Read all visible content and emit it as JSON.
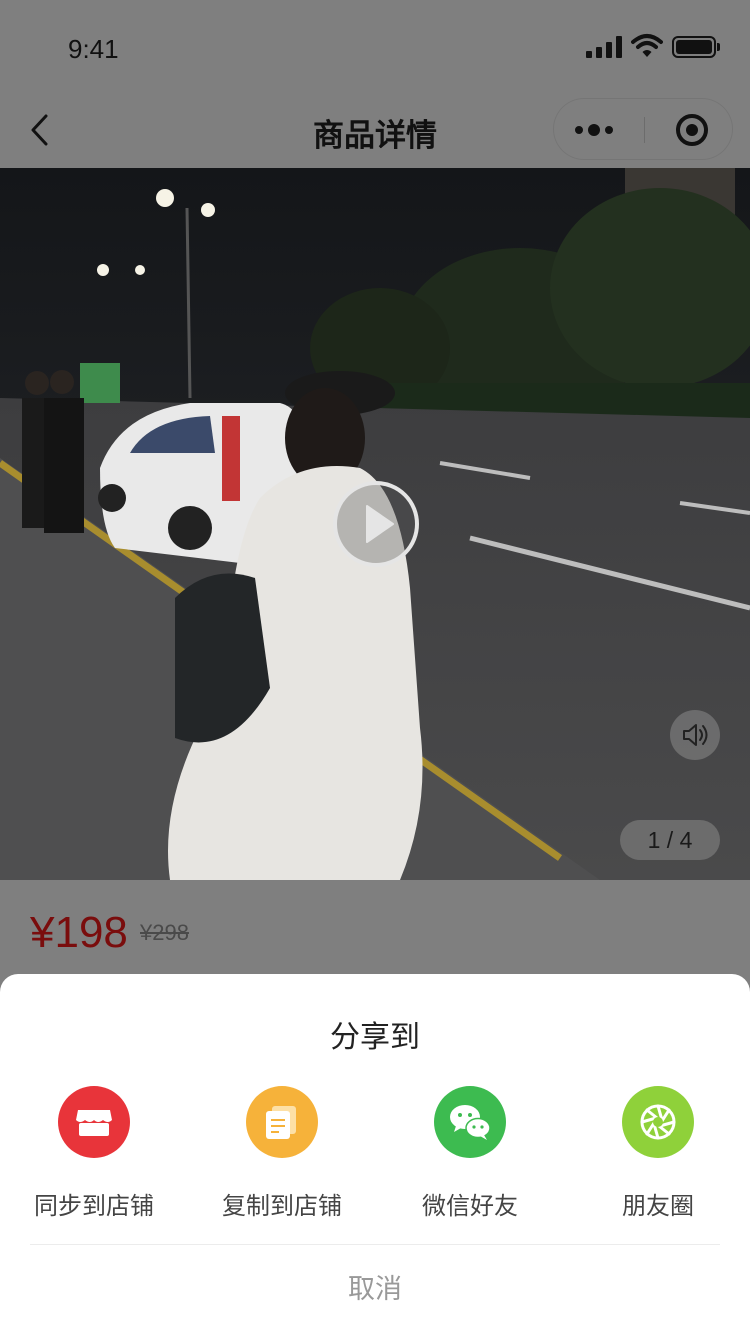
{
  "status_bar": {
    "time": "9:41"
  },
  "nav": {
    "title": "商品详情"
  },
  "media": {
    "page_indicator": "1 / 4"
  },
  "price": {
    "current": "¥198",
    "original": "¥298"
  },
  "share_sheet": {
    "title": "分享到",
    "options": [
      {
        "label": "同步到店铺",
        "icon": "store-icon",
        "color": "#e8343a"
      },
      {
        "label": "复制到店铺",
        "icon": "copy-icon",
        "color": "#f6b23a"
      },
      {
        "label": "微信好友",
        "icon": "wechat-icon",
        "color": "#3dbb50"
      },
      {
        "label": "朋友圈",
        "icon": "moments-icon",
        "color": "#8fd13a"
      }
    ],
    "cancel": "取消"
  },
  "colors": {
    "overlay": "#7f7f7f",
    "price_red": "#e02e24",
    "sheet_bg": "#ffffff"
  }
}
